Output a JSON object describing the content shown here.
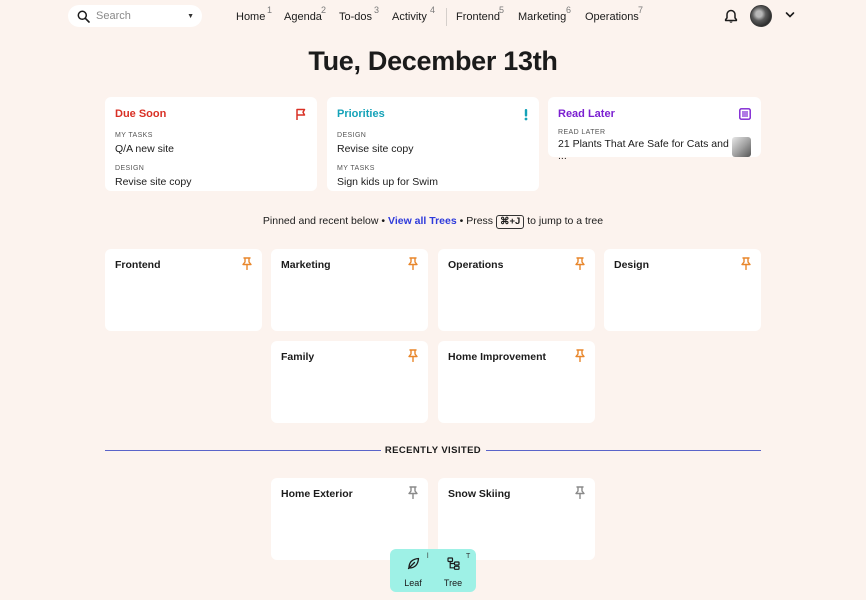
{
  "search": {
    "placeholder": "Search"
  },
  "nav": [
    {
      "label": "Home",
      "shortcut": "1"
    },
    {
      "label": "Agenda",
      "shortcut": "2"
    },
    {
      "label": "To-dos",
      "shortcut": "3"
    },
    {
      "label": "Activity",
      "shortcut": "4"
    },
    {
      "label": "Frontend",
      "shortcut": "5"
    },
    {
      "label": "Marketing",
      "shortcut": "6"
    },
    {
      "label": "Operations",
      "shortcut": "7"
    }
  ],
  "page_title": "Tue, December 13th",
  "summary": {
    "due_soon": {
      "title": "Due Soon",
      "color": "#d93025",
      "icon": "flag-icon",
      "items": [
        {
          "label": "MY TASKS",
          "value": "Q/A new site"
        },
        {
          "label": "DESIGN",
          "value": "Revise site copy"
        }
      ]
    },
    "priorities": {
      "title": "Priorities",
      "color": "#14a2b8",
      "icon": "exclamation-icon",
      "items": [
        {
          "label": "DESIGN",
          "value": "Revise site copy"
        },
        {
          "label": "MY TASKS",
          "value": "Sign kids up for Swim"
        }
      ]
    },
    "read_later": {
      "title": "Read Later",
      "color": "#7b1fd1",
      "icon": "list-icon",
      "items": [
        {
          "label": "READ LATER",
          "value": "21 Plants That Are Safe for Cats and ..."
        }
      ]
    }
  },
  "pinned": {
    "prefix": "Pinned and recent below •",
    "link": "View all Trees",
    "middle": "• Press",
    "shortcut": "⌘+J",
    "suffix": "to jump to a tree"
  },
  "pinned_trees": [
    "Frontend",
    "Marketing",
    "Operations",
    "Design",
    "Family",
    "Home Improvement"
  ],
  "recent": {
    "label": "RECENTLY VISITED",
    "trees": [
      "Home Exterior",
      "Snow Skiing"
    ]
  },
  "actions": {
    "leaf": {
      "label": "Leaf",
      "shortcut": "l"
    },
    "tree": {
      "label": "Tree",
      "shortcut": "T"
    }
  },
  "colors": {
    "accent": "#2e3adb",
    "pin": "#e8862a",
    "action_bar": "#9ef1e6",
    "background": "#fcf3ee"
  }
}
